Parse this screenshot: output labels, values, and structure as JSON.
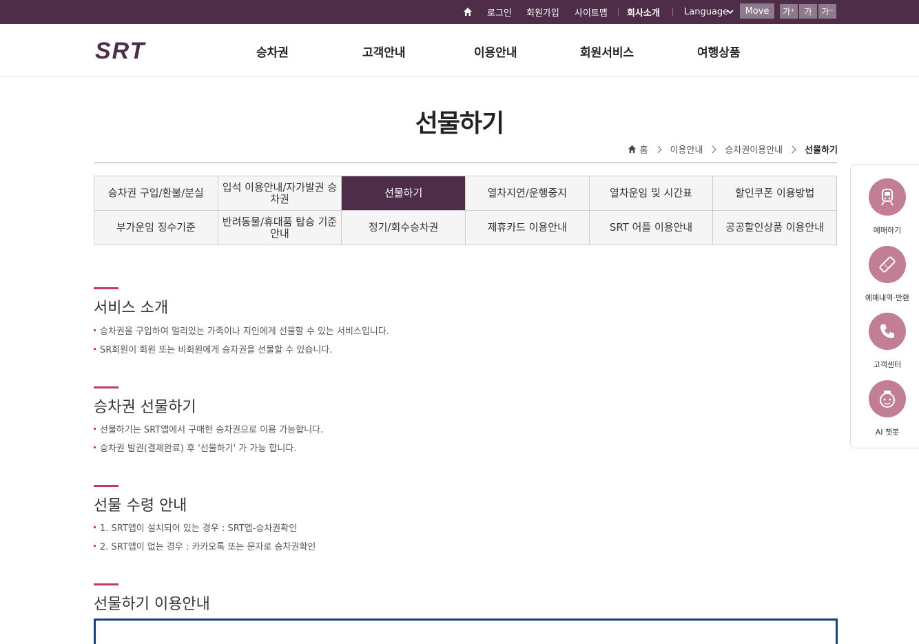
{
  "topbar": {
    "login": "로그인",
    "join": "회원가입",
    "sitemap": "사이트맵",
    "company": "회사소개",
    "language": "Language",
    "move": "Move",
    "font_up": "가⁺",
    "font_normal": "가",
    "font_down": "가⁻"
  },
  "gnb": [
    "승차권",
    "고객안내",
    "이용안내",
    "회원서비스",
    "여행상품"
  ],
  "page_title": "선물하기",
  "breadcrumb": [
    "홈",
    "이용안내",
    "승차권이용안내",
    "선물하기"
  ],
  "tabs": [
    {
      "label": "승차권 구입/환불/분실",
      "active": false
    },
    {
      "label": "입석 이용안내/자가발권 승차권",
      "active": false
    },
    {
      "label": "선물하기",
      "active": true
    },
    {
      "label": "열차지연/운행중지",
      "active": false
    },
    {
      "label": "열차운임 및 시간표",
      "active": false
    },
    {
      "label": "할인쿠폰 이용방법",
      "active": false
    },
    {
      "label": "부가운임 징수기준",
      "active": false
    },
    {
      "label": "반려동물/휴대품 탑승 기준 안내",
      "active": false
    },
    {
      "label": "정기/회수승차권",
      "active": false
    },
    {
      "label": "제휴카드 이용안내",
      "active": false
    },
    {
      "label": "SRT 어플 이용안내",
      "active": false
    },
    {
      "label": "공공할인상품 이용안내",
      "active": false
    }
  ],
  "sections": [
    {
      "title": "서비스 소개",
      "items": [
        "승차권을 구입하여 멀리있는 가족이나 지인에게 선물할 수 있는 서비스입니다.",
        "SR회원이 회원 또는 비회원에게 승차권을 선물할 수 있습니다."
      ]
    },
    {
      "title": "승차권 선물하기",
      "items": [
        "선물하기는 SRT앱에서 구매한 승차권으로 이용 가능합니다.",
        "승차권 발권(결제완료) 후 '선물하기' 가 가능 합니다."
      ]
    },
    {
      "title": "선물 수령 안내",
      "items": [
        "1. SRT앱이 설치되어 있는 경우 : SRT앱-승차권확인",
        "2. SRT앱이 없는 경우 : 카카오톡 또는 문자로 승차권확인"
      ]
    },
    {
      "title": "선물하기 이용안내",
      "items": []
    }
  ],
  "quick_menu": [
    "예매하기",
    "예매내역·반환",
    "고객센터",
    "AI 챗봇"
  ],
  "colors": {
    "brand": "#4d2d47",
    "accent": "#c4386d",
    "quick": "#c27e94"
  }
}
